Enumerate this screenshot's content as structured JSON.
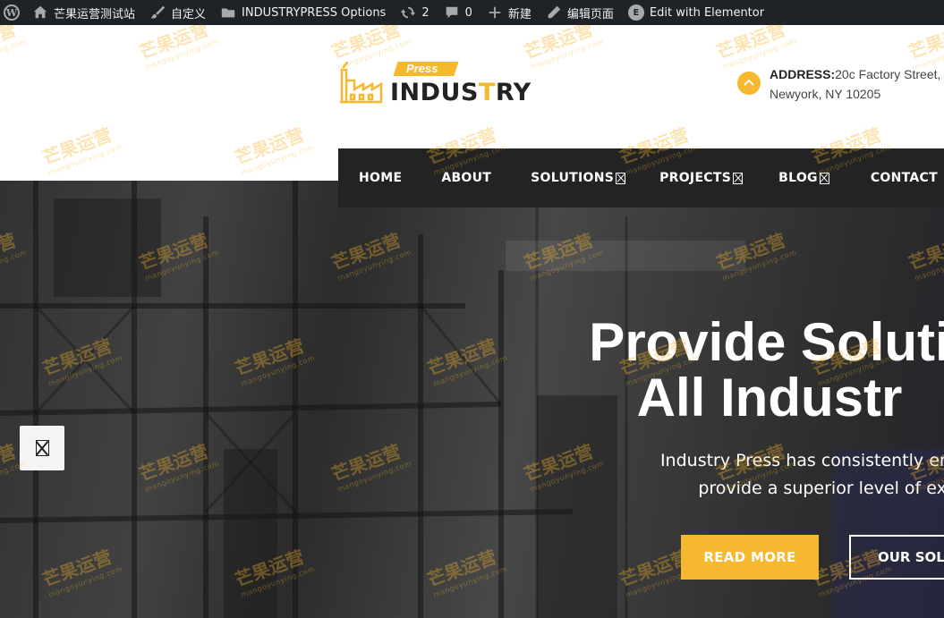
{
  "admin_bar": {
    "site_name": "芒果运营测试站",
    "customize": "自定义",
    "theme_options": "INDUSTRYPRESS Options",
    "updates_count": "2",
    "comments_count": "0",
    "new_label": "新建",
    "edit_page": "编辑页面",
    "elementor": "Edit with Elementor"
  },
  "logo": {
    "tag": "Press",
    "word_start": "INDUS",
    "word_accent": "T",
    "word_end": "RY"
  },
  "address": {
    "label": "ADDRESS:",
    "line1": "20c Factory Street,",
    "line2": "Newyork, NY 10205"
  },
  "nav": {
    "items": [
      {
        "label": "HOME"
      },
      {
        "label": "ABOUT"
      },
      {
        "label": "SOLUTIONS"
      },
      {
        "label": "PROJECTS"
      },
      {
        "label": "BLOG"
      },
      {
        "label": "CONTACT"
      }
    ]
  },
  "hero": {
    "title_line1": "Provide Soluti",
    "title_line2": "All Industr",
    "subtitle_line1": "Industry Press has consistently embrace",
    "subtitle_line2": "provide a superior level of exce",
    "btn_primary": "READ MORE",
    "btn_secondary": "OUR SOLU"
  },
  "watermark": {
    "text": "芒果运营",
    "subtext": "mangoyunying.com"
  },
  "colors": {
    "accent": "#f5b82e",
    "admin_bar": "#1d2327",
    "nav_bg": "#232323"
  }
}
